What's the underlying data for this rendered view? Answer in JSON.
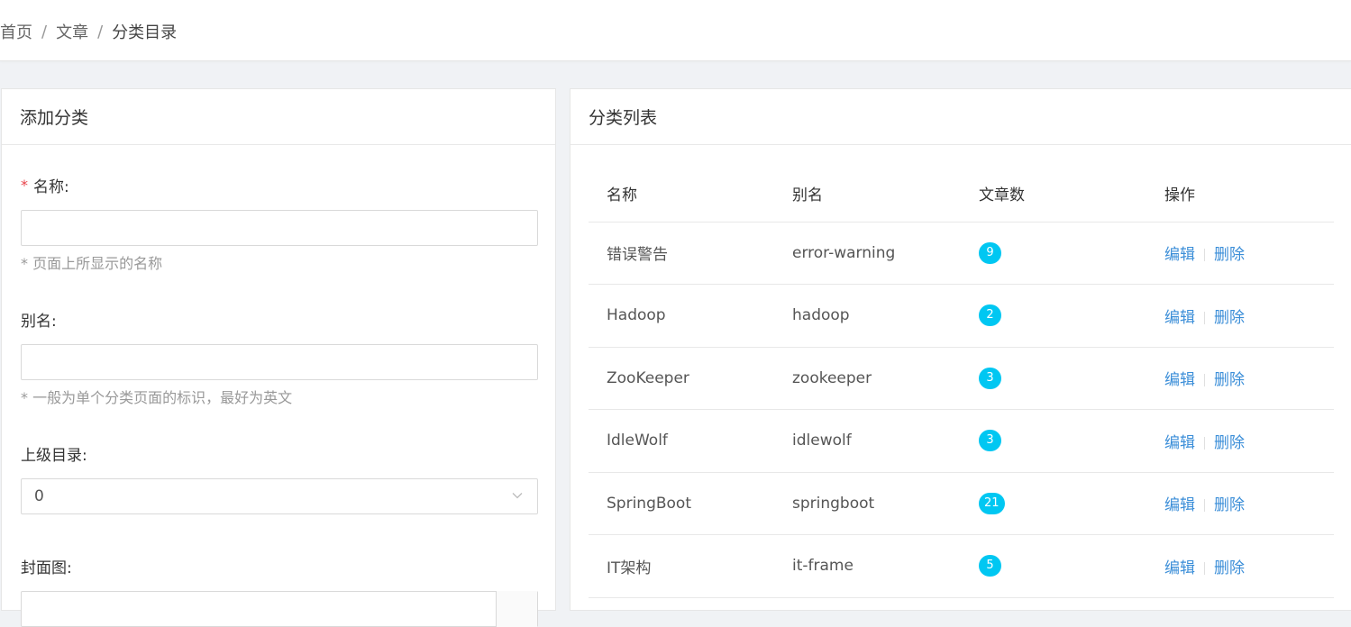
{
  "breadcrumb": {
    "items": [
      "首页",
      "文章"
    ],
    "current": "分类目录",
    "separator": "/"
  },
  "add_panel": {
    "title": "添加分类",
    "name_label": "名称:",
    "required_mark": "*",
    "name_value": "",
    "name_hint": "* 页面上所显示的名称",
    "alias_label": "别名:",
    "alias_value": "",
    "alias_hint": "* 一般为单个分类页面的标识，最好为英文",
    "parent_label": "上级目录:",
    "parent_value": "0",
    "cover_label": "封面图:"
  },
  "list_panel": {
    "title": "分类列表",
    "columns": [
      "名称",
      "别名",
      "文章数",
      "操作"
    ],
    "edit_label": "编辑",
    "delete_label": "删除",
    "badge_color": "#00c7f2",
    "link_color": "#3b8ed8",
    "rows": [
      {
        "name": "错误警告",
        "alias": "error-warning",
        "count": "9"
      },
      {
        "name": "Hadoop",
        "alias": "hadoop",
        "count": "2"
      },
      {
        "name": "ZooKeeper",
        "alias": "zookeeper",
        "count": "3"
      },
      {
        "name": "IdleWolf",
        "alias": "idlewolf",
        "count": "3"
      },
      {
        "name": "SpringBoot",
        "alias": "springboot",
        "count": "21"
      },
      {
        "name": "IT架构",
        "alias": "it-frame",
        "count": "5"
      }
    ]
  }
}
